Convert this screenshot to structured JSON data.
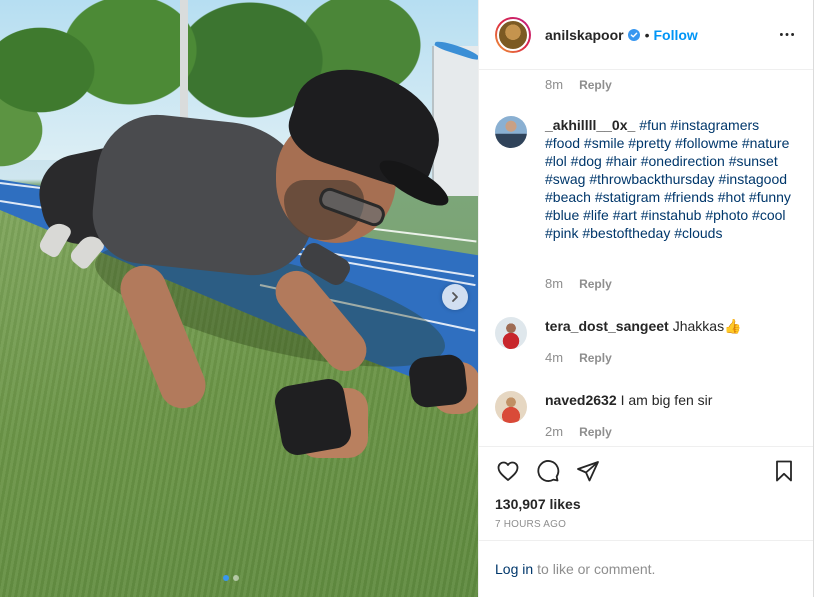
{
  "post": {
    "author": "anilskapoor",
    "follow_label": "Follow",
    "separator": "•",
    "likes": "130,907 likes",
    "timestamp": "7 HOURS AGO"
  },
  "comments": [
    {
      "username": "",
      "text": "",
      "age": "8m",
      "reply": "Reply"
    },
    {
      "username": "_akhillll__0x_",
      "text": "#fun #instagramers #food #smile #pretty #followme #nature #lol #dog #hair #onedirection #sunset #swag #throwbackthursday #instagood #beach #statigram #friends #hot #funny #blue #life #art #instahub #photo #cool #pink #bestoftheday #clouds",
      "age": "8m",
      "reply": "Reply"
    },
    {
      "username": "tera_dost_sangeet",
      "text": "Jhakkas👍",
      "age": "4m",
      "reply": "Reply"
    },
    {
      "username": "naved2632",
      "text": "I am big fen sir",
      "age": "2m",
      "reply": "Reply"
    }
  ],
  "login": {
    "link": "Log in",
    "rest": "to like or comment."
  },
  "icons": {
    "verified": "verified-badge-icon",
    "more": "more-options-icon",
    "like": "heart-icon",
    "comment": "comment-bubble-icon",
    "share": "paper-plane-icon",
    "save": "bookmark-icon",
    "next": "chevron-right-icon"
  },
  "colors": {
    "link": "#0095f6",
    "hashtag": "#00376b",
    "muted": "#8e8e8e",
    "text": "#262626"
  }
}
